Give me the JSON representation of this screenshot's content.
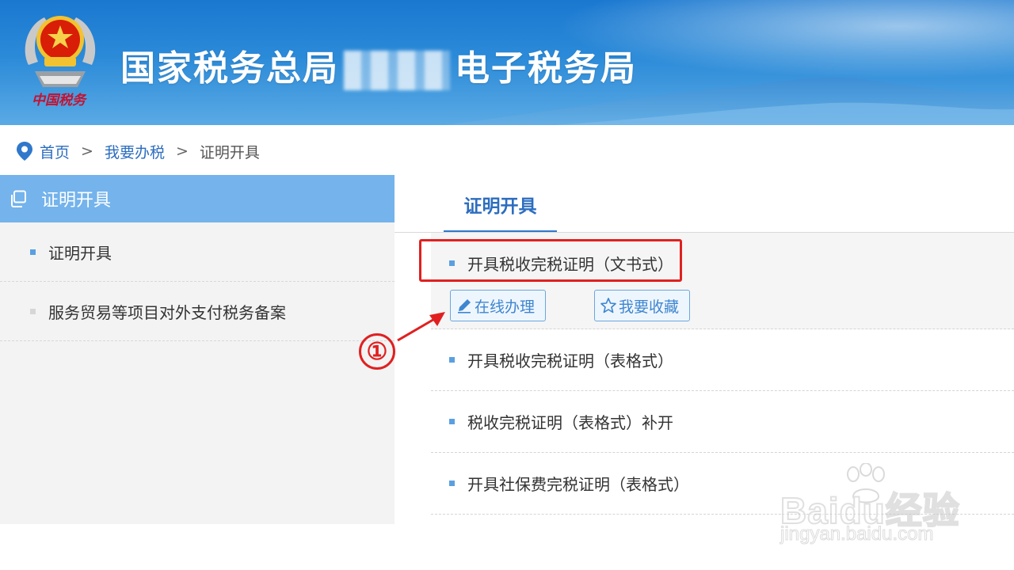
{
  "header": {
    "title_prefix": "国家税务总局",
    "title_suffix": "电子税务局",
    "emblem_label": "中国税务"
  },
  "breadcrumb": {
    "items": [
      "首页",
      "我要办税",
      "证明开具"
    ],
    "separator": ">"
  },
  "sidebar": {
    "heading": "证明开具",
    "items": [
      {
        "label": "证明开具"
      },
      {
        "label": "服务贸易等项目对外支付税务备案"
      }
    ]
  },
  "main": {
    "tab_label": "证明开具",
    "items": [
      {
        "label": "开具税收完税证明（文书式）"
      },
      {
        "label": "开具税收完税证明（表格式）"
      },
      {
        "label": "税收完税证明（表格式）补开"
      },
      {
        "label": "开具社保费完税证明（表格式）"
      }
    ],
    "actions": {
      "online_label": "在线办理",
      "favorite_label": "我要收藏"
    }
  },
  "annotation": {
    "step_label": "①"
  },
  "watermark": {
    "brand": "Baidu经验",
    "url": "jingyan.baidu.com"
  },
  "colors": {
    "header_blue": "#1a78d0",
    "sidebar_active": "#74b3ec",
    "link_blue": "#2c6dbf",
    "annotation_red": "#e02020"
  }
}
